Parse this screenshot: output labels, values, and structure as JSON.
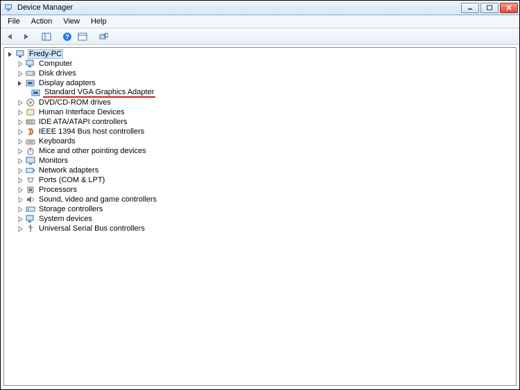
{
  "window": {
    "title": "Device Manager"
  },
  "menu": {
    "file": "File",
    "action": "Action",
    "view": "View",
    "help": "Help"
  },
  "root": {
    "name": "Fredy-PC"
  },
  "categories": [
    {
      "id": "computer",
      "label": "Computer"
    },
    {
      "id": "disk",
      "label": "Disk drives"
    },
    {
      "id": "display",
      "label": "Display adapters",
      "expanded": true,
      "children": [
        {
          "id": "vga",
          "label": "Standard VGA Graphics Adapter",
          "highlighted": true
        }
      ]
    },
    {
      "id": "dvd",
      "label": "DVD/CD-ROM drives"
    },
    {
      "id": "hid",
      "label": "Human Interface Devices"
    },
    {
      "id": "ide",
      "label": "IDE ATA/ATAPI controllers"
    },
    {
      "id": "ieee1394",
      "label": "IEEE 1394 Bus host controllers"
    },
    {
      "id": "keyboards",
      "label": "Keyboards"
    },
    {
      "id": "mice",
      "label": "Mice and other pointing devices"
    },
    {
      "id": "monitors",
      "label": "Monitors"
    },
    {
      "id": "network",
      "label": "Network adapters"
    },
    {
      "id": "ports",
      "label": "Ports (COM & LPT)"
    },
    {
      "id": "processors",
      "label": "Processors"
    },
    {
      "id": "sound",
      "label": "Sound, video and game controllers"
    },
    {
      "id": "storage",
      "label": "Storage controllers"
    },
    {
      "id": "system",
      "label": "System devices"
    },
    {
      "id": "usb",
      "label": "Universal Serial Bus controllers"
    }
  ]
}
